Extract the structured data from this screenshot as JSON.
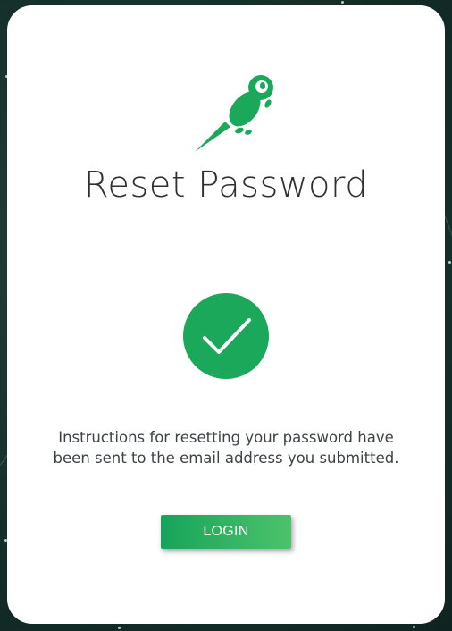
{
  "page": {
    "title": "Reset Password",
    "message": "Instructions for resetting your password have been sent to the email address you submitted.",
    "login_label": "LOGIN"
  },
  "icons": {
    "logo": "rocket-astronaut-icon",
    "success": "checkmark-icon"
  },
  "colors": {
    "accent": "#1ca85b",
    "button_gradient_start": "#16a45a",
    "button_gradient_end": "#4cc36a",
    "title": "#2d2f31",
    "text": "#3d4247",
    "background": "#16302c"
  }
}
